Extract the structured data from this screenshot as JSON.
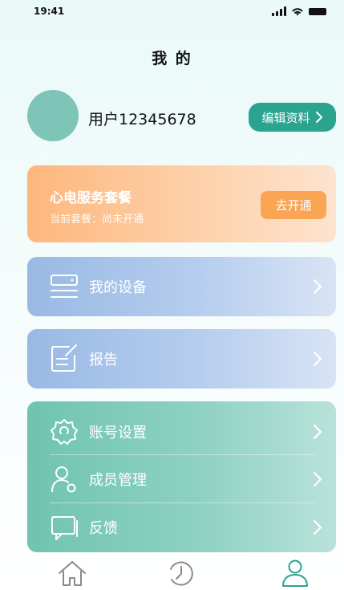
{
  "status_bar": {
    "time": "19:41"
  },
  "header": {
    "title": "我 的"
  },
  "profile": {
    "username": "用户12345678",
    "edit_label": "编辑资料"
  },
  "service_card": {
    "title": "心电服务套餐",
    "subtitle": "当前套餐：尚未开通",
    "button_label": "去开通"
  },
  "menu": {
    "device": {
      "label": "我的设备",
      "icon": "device-icon"
    },
    "report": {
      "label": "报告",
      "icon": "report-icon"
    },
    "settings": [
      {
        "label": "账号设置",
        "icon": "gear-icon"
      },
      {
        "label": "成员管理",
        "icon": "member-icon"
      },
      {
        "label": "反馈",
        "icon": "feedback-icon"
      }
    ]
  },
  "tabbar": {
    "items": [
      {
        "icon": "home-icon"
      },
      {
        "icon": "history-icon"
      },
      {
        "icon": "user-icon",
        "active": true
      }
    ]
  },
  "colors": {
    "accent": "#2aa38f",
    "avatar": "#7ec5b7",
    "service_orange": "#f9a553",
    "tab_inactive": "#8a8a8a"
  }
}
